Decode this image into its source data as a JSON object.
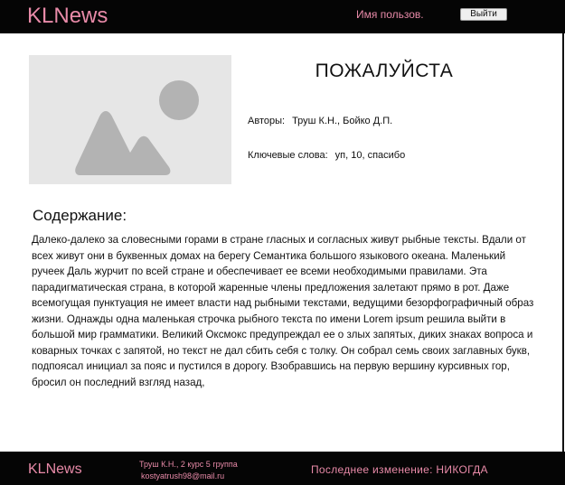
{
  "header": {
    "brand": "KLNews",
    "username": "Имя пользов.",
    "logout_label": "Выйти"
  },
  "article": {
    "title": "ПОЖАЛУЙСТА",
    "authors_label": "Авторы:",
    "authors_value": "Труш К.Н.,  Бойко Д.П.",
    "keywords_label": "Ключевые слова:",
    "keywords_value": "уп, 10, спасибо",
    "content_heading": "Содержание:",
    "content_text": "Далеко-далеко за словесными горами в стране гласных и согласных живут  рыбные тексты. Вдали от всех живут они в буквенных домах на берегу  Семантика большого языкового океана. Маленький ручеек Даль журчит по  всей стране и обеспечивает ее всеми необходимыми правилами. Эта  парадигматическая страна, в которой жаренные члены предложения залетают  прямо в рот. Даже всемогущая пунктуация не имеет власти над рыбными  текстами, ведущими безорфографичный образ жизни. Однажды одна маленькая  строчка рыбного текста по имени Lorem ipsum решила выйти в большой мир  грамматики. Великий Оксмокс предупреждал ее о злых запятых, диких знаках  вопроса и коварных точках с запятой, но текст не дал сбить себя с  толку. Он собрал семь своих заглавных букв, подпоясал инициал за пояс и  пустился в дорогу. Взобравшись на первую вершину курсивных гор, бросил  он последний взгляд назад,"
  },
  "footer": {
    "brand": "KLNews",
    "author_line": "Труш К.Н., 2 курс 5 группа",
    "email": "kostyatrush98@mail.ru",
    "last_modified": "Последнее изменение: НИКОГДА"
  },
  "icons": {
    "image_placeholder": "image-placeholder-icon"
  },
  "colors": {
    "bar_background": "#050505",
    "accent_pink": "#e88aa8",
    "placeholder_bg": "#e6e6e6",
    "placeholder_shape": "#b3b3b3"
  }
}
